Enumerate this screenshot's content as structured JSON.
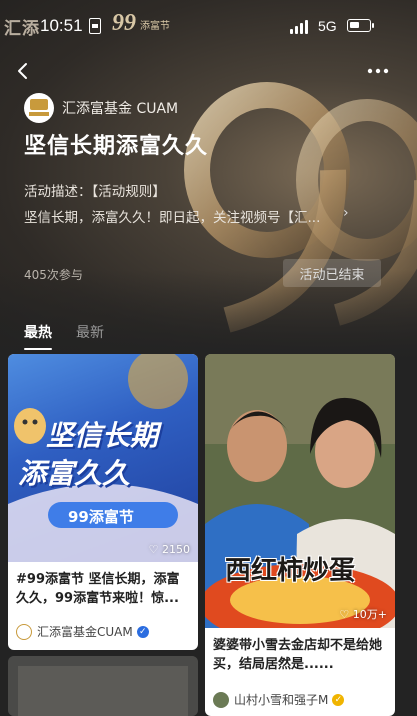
{
  "status_bar": {
    "brand_text": "汇添",
    "time": "10:51",
    "festival_number": "99",
    "festival_text": "添富节",
    "network": "5G"
  },
  "activity": {
    "org_name": "汇添富基金 CUAM",
    "title": "坚信长期添富久久",
    "description_label": "活动描述：【活动规则】",
    "description_text": "坚信长期，添富久久！即日起，关注视频号【汇...",
    "participants": "405次参与",
    "status_button": "活动已结束"
  },
  "tabs": [
    {
      "label": "最热",
      "active": true
    },
    {
      "label": "最新",
      "active": false
    }
  ],
  "cards": [
    {
      "thumb_line1": "坚信长期",
      "thumb_line2": "添富久久",
      "thumb_badge": "99添富节",
      "likes": "♡ 2150",
      "title": "#99添富节 坚信长期，添富久久，99添富节来啦！惊...",
      "author": "汇添富基金CUAM",
      "verified_color": "#2b6de0"
    },
    {
      "thumb_caption": "西红柿炒蛋",
      "likes": "♡ 10万+",
      "title": "婆婆带小雪去金店却不是给她买，结局居然是......",
      "author": "山村小雪和强子M",
      "verified_color": "#f0b400"
    }
  ]
}
